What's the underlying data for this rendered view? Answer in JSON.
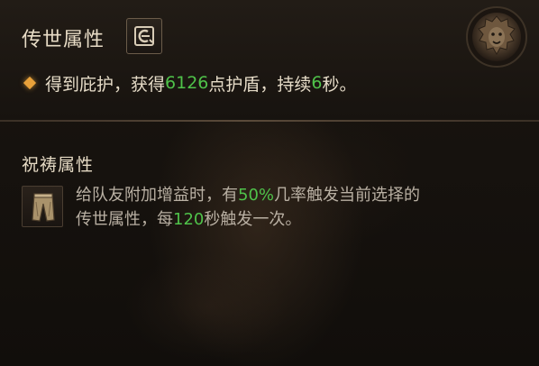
{
  "legendary": {
    "title": "传世属性",
    "icon": "aspect-sigil-icon",
    "emblem": "lion-head-emblem-icon",
    "effect": {
      "part1": "得到庇护，获得",
      "value1": "6126",
      "part2": "点护盾，持续",
      "value2": "6",
      "part3": "秒。"
    }
  },
  "blessing": {
    "title": "祝祷属性",
    "icon": "pants-icon",
    "desc": {
      "part1": "给队友附加增益时，有",
      "value1": "50%",
      "part2": "几率触发当前选择的",
      "part3": "传世属性，每",
      "value2": "120",
      "part4": "秒触发一次。"
    }
  },
  "colors": {
    "highlight_value": "#4fc24a",
    "bullet": "#e8a13a",
    "title_text": "#e8dcc6",
    "body_text": "#b9b0a3"
  }
}
